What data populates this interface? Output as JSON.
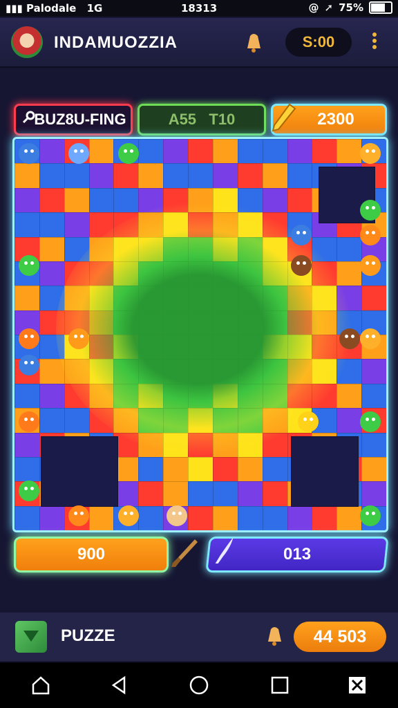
{
  "status_bar": {
    "carrier": "Palodale",
    "network": "1G",
    "clock": "18313",
    "battery": "75%",
    "battery_level": 0.75
  },
  "header": {
    "title": "INDAMUOZZIA",
    "coins": "S:00",
    "icons": [
      "avatar",
      "bell-icon",
      "kebab-menu-icon"
    ]
  },
  "top_stats": {
    "red_label": "BUZ8U-FING",
    "green_label": "A55   T10",
    "orange_value": "2300"
  },
  "board": {
    "type": "jigsaw-puzzle",
    "colors": [
      "#ff3b30",
      "#ff9f1a",
      "#ffe31a",
      "#3ecb45",
      "#2f6ee8",
      "#7a3ee6",
      "#1b1b4a"
    ]
  },
  "bottom_stats": {
    "left_value": "900",
    "right_value": "013"
  },
  "footer": {
    "label": "PUZZE",
    "coins": "44 503"
  },
  "nav": [
    "home-icon",
    "back-icon",
    "circle-home-icon",
    "recents-icon",
    "close-x-icon"
  ]
}
